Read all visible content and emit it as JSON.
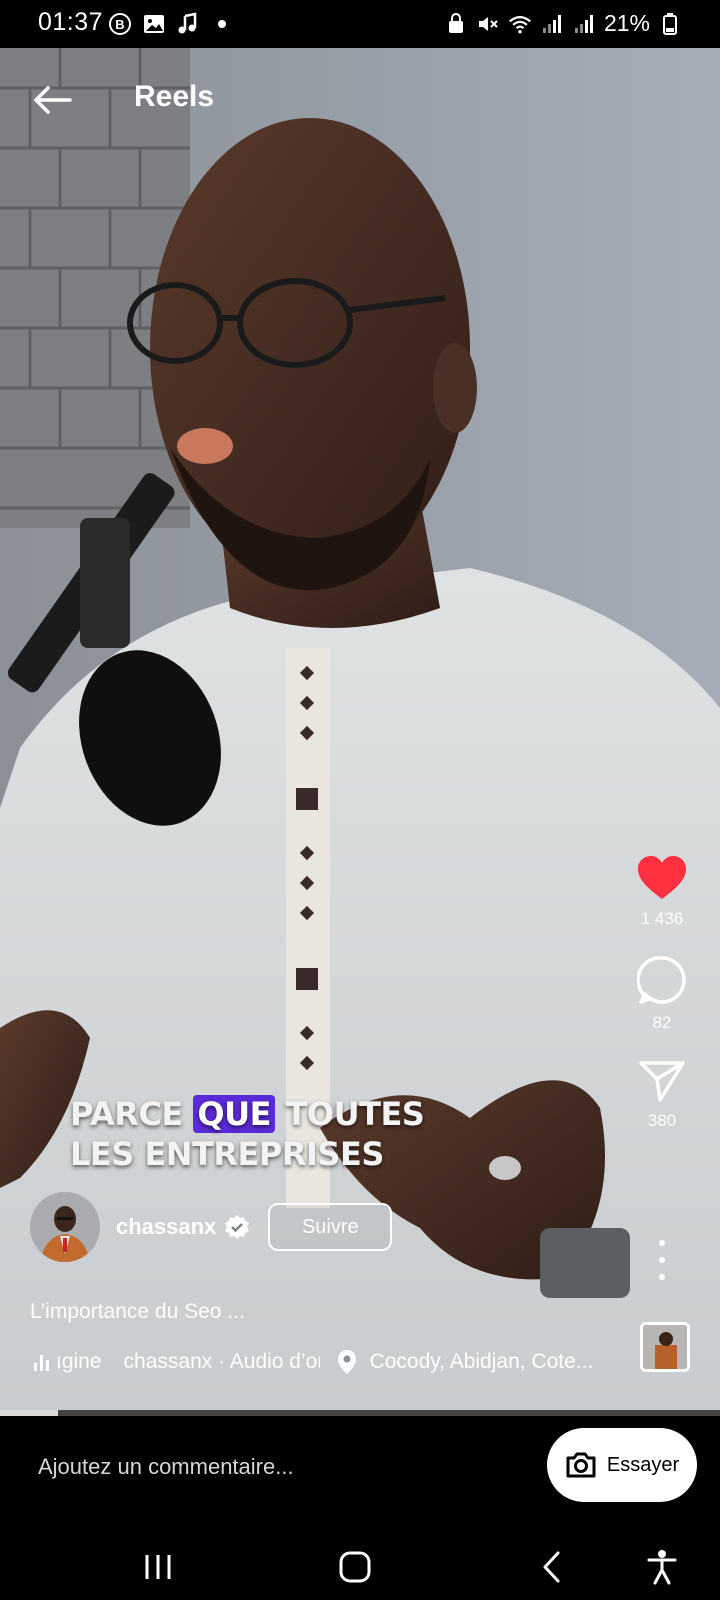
{
  "status_bar": {
    "time": "01:37",
    "battery": "21%",
    "left_icons": [
      "b-icon",
      "image-icon",
      "music-note-icon",
      "dot-icon"
    ],
    "right_icons": [
      "lock-icon",
      "mute-icon",
      "wifi-icon",
      "signal-icon",
      "signal-icon",
      "battery-icon"
    ]
  },
  "header": {
    "title": "Reels"
  },
  "overlay_caption": {
    "line1_before": "PARCE ",
    "line1_highlight": "QUE",
    "line1_after": " TOUTES",
    "line2": "LES ENTREPRISES",
    "highlight_color": "#5b2ad8"
  },
  "actions": {
    "like_count": "1 436",
    "comment_count": "82",
    "share_count": "380",
    "like_color": "#ff3040"
  },
  "author": {
    "username": "chassanx",
    "follow_label": "Suivre"
  },
  "post": {
    "description": "L’importance du Seo ...",
    "audio_prefix": "ıgine",
    "audio": "chassanx · Audio d’or",
    "location": "Cocody, Abidjan, Cote..."
  },
  "progress": {
    "fraction": 0.08
  },
  "comment_bar": {
    "placeholder": "Ajoutez un commentaire...",
    "try_label": "Essayer"
  },
  "nav_bar": {
    "icons": [
      "recent-apps-icon",
      "home-icon",
      "back-icon",
      "accessibility-icon"
    ]
  }
}
